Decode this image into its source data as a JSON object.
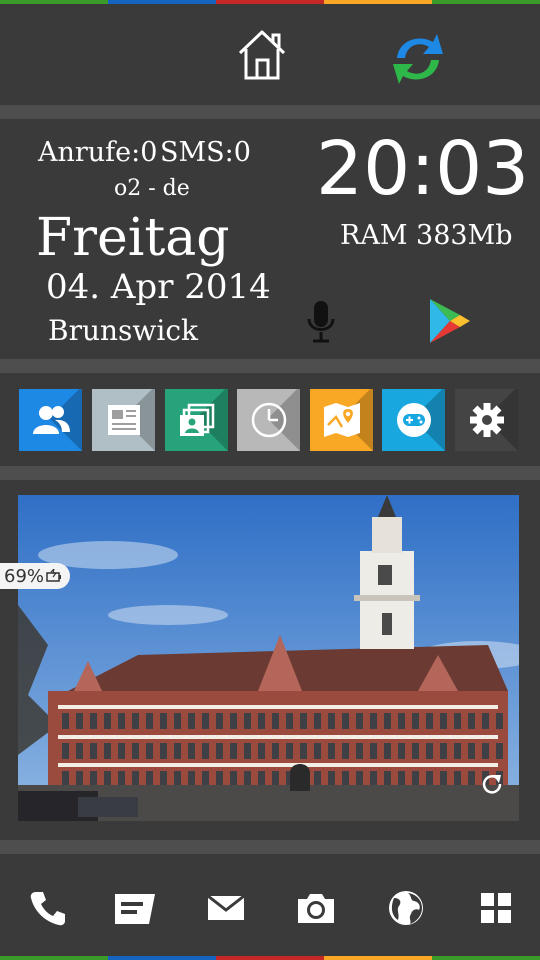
{
  "stripe_colors": [
    "#3a9a2a",
    "#1565c0",
    "#c62828",
    "#f9a825",
    "#3a9a2a"
  ],
  "header": {
    "home_icon": "home-icon",
    "sync_icon": "sync-icon"
  },
  "info": {
    "calls_label": "Anrufe:0",
    "sms_label": "SMS:0",
    "carrier": "o2 - de",
    "weekday": "Freitag",
    "date": "04. Apr 2014",
    "city": "Brunswick",
    "time": "20:03",
    "ram": "RAM 383Mb"
  },
  "actions": {
    "mic_icon": "microphone-icon",
    "play_icon": "play-store-icon"
  },
  "apps": [
    {
      "name": "contacts-icon",
      "color": "#1e88e5"
    },
    {
      "name": "news-icon",
      "color": "#b0bec5"
    },
    {
      "name": "gallery-icon",
      "color": "#26a37a"
    },
    {
      "name": "clock-icon",
      "color": "#b8b8b8"
    },
    {
      "name": "maps-icon",
      "color": "#f9a825"
    },
    {
      "name": "games-icon",
      "color": "#19a7e0"
    },
    {
      "name": "settings-icon",
      "color": "#444444"
    }
  ],
  "photo": {
    "battery": "69%",
    "refresh_icon": "refresh-icon"
  },
  "dock": [
    "phone-icon",
    "messages-icon",
    "mail-icon",
    "camera-icon",
    "browser-icon",
    "apps-grid-icon"
  ]
}
